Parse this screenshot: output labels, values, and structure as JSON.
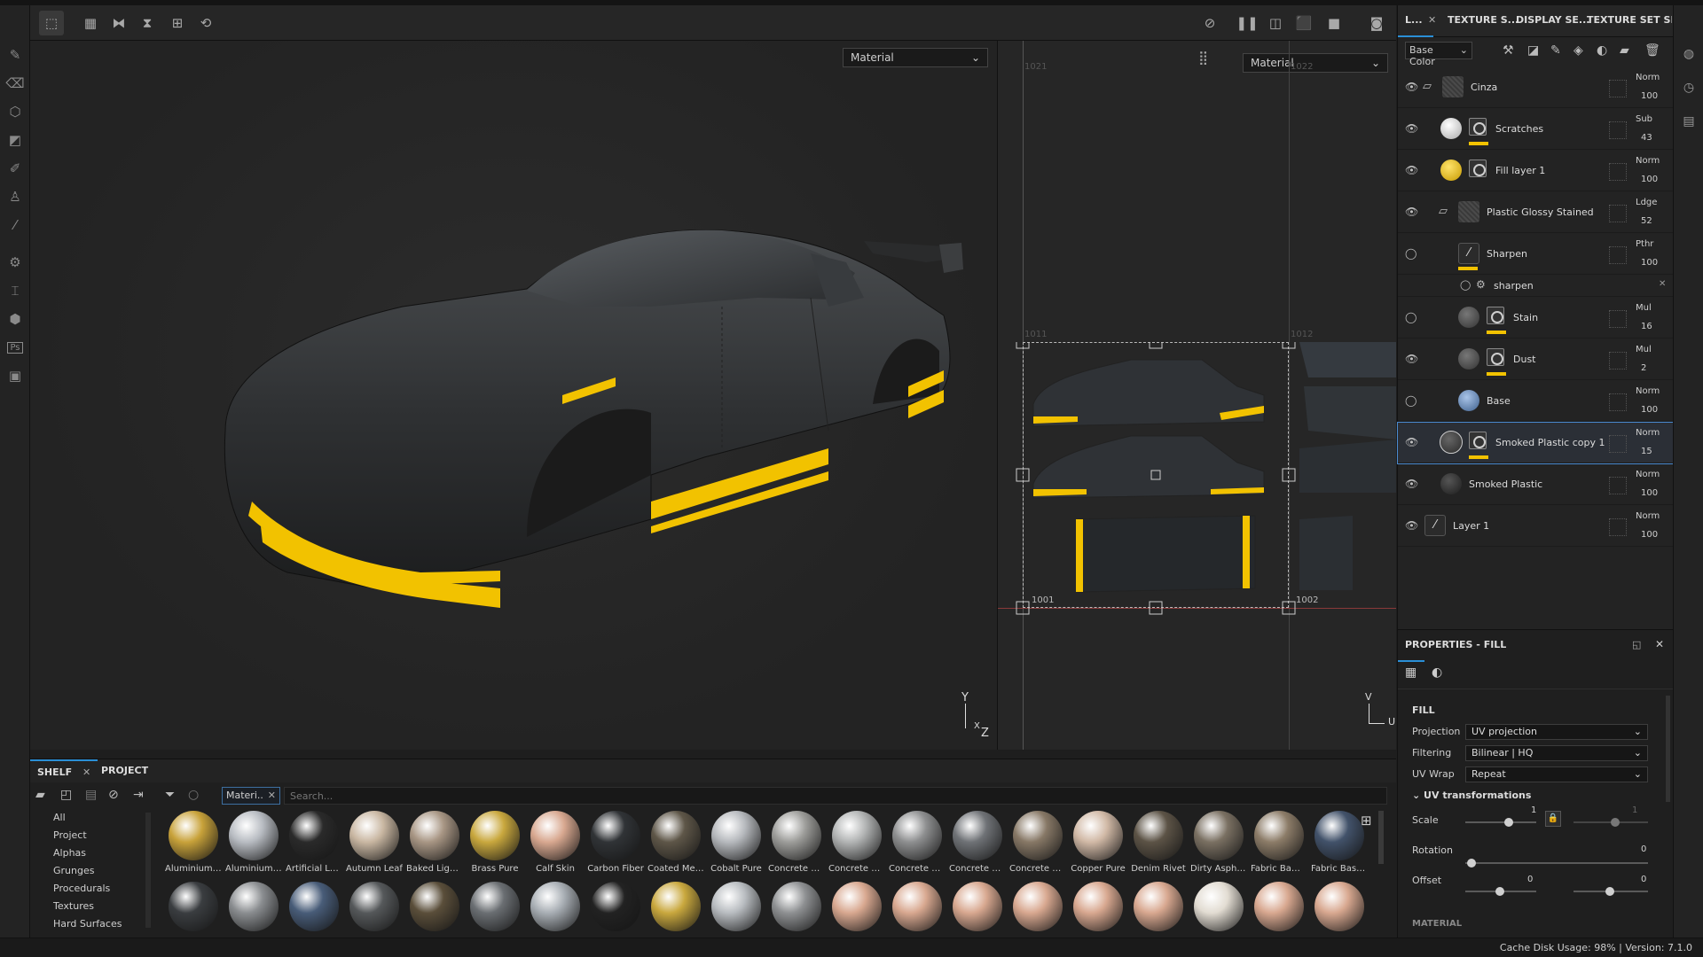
{
  "viewport3d": {
    "mode_label": "Material"
  },
  "viewport2d": {
    "mode_label": "Material",
    "udim": {
      "t1001": "1001",
      "t1002": "1002",
      "t1011": "1011",
      "t1012": "1012",
      "t1021": "1021",
      "t1022": "1022"
    },
    "axis": {
      "v": "V",
      "u": "U"
    }
  },
  "gizmo3d": {
    "y": "Y",
    "x": "X",
    "z": "Z"
  },
  "right_tabs": {
    "layers": "L...",
    "texture_set_list": "TEXTURE S...",
    "display_settings": "DISPLAY SE...",
    "texture_set_settings": "TEXTURE SET SE..."
  },
  "channel_select": "Base Color",
  "layers": [
    {
      "name": "Cinza",
      "blend": "Norm",
      "opacity": "100"
    },
    {
      "name": "Scratches",
      "blend": "Sub",
      "opacity": "43"
    },
    {
      "name": "Fill layer 1",
      "blend": "Norm",
      "opacity": "100"
    },
    {
      "name": "Plastic Glossy Stained",
      "blend": "Ldge",
      "opacity": "52"
    },
    {
      "name": "Sharpen",
      "blend": "Pthr",
      "opacity": "100"
    },
    {
      "name": "sharpen",
      "blend": "",
      "opacity": ""
    },
    {
      "name": "Stain",
      "blend": "Mul",
      "opacity": "16"
    },
    {
      "name": "Dust",
      "blend": "Mul",
      "opacity": "2"
    },
    {
      "name": "Base",
      "blend": "Norm",
      "opacity": "100"
    },
    {
      "name": "Smoked Plastic copy 1",
      "blend": "Norm",
      "opacity": "15"
    },
    {
      "name": "Smoked Plastic",
      "blend": "Norm",
      "opacity": "100"
    },
    {
      "name": "Layer 1",
      "blend": "Norm",
      "opacity": "100"
    }
  ],
  "properties": {
    "title": "PROPERTIES - FILL",
    "section": "FILL",
    "projection_label": "Projection",
    "projection_value": "UV projection",
    "filtering_label": "Filtering",
    "filtering_value": "Bilinear | HQ",
    "uvwrap_label": "UV Wrap",
    "uvwrap_value": "Repeat",
    "uvt_label": "UV transformations",
    "scale_label": "Scale",
    "scale_value": "1",
    "scale_value2": "1",
    "rotation_label": "Rotation",
    "rotation_value": "0",
    "offset_label": "Offset",
    "offset_value": "0",
    "offset_value2": "0",
    "next_section": "MATERIAL"
  },
  "shelf": {
    "tab_shelf": "SHELF",
    "tab_project": "PROJECT",
    "filter_chip": "Materi..",
    "search_placeholder": "Search...",
    "categories": [
      "All",
      "Project",
      "Alphas",
      "Grunges",
      "Procedurals",
      "Textures",
      "Hard Surfaces"
    ],
    "materials_row1": [
      {
        "name": "Aluminium ...",
        "color": "#c8a23a"
      },
      {
        "name": "Aluminium ...",
        "color": "#b8bcc2"
      },
      {
        "name": "Artificial Lea...",
        "color": "#2a2a2a"
      },
      {
        "name": "Autumn Leaf",
        "color": "#c9b7a2"
      },
      {
        "name": "Baked Light...",
        "color": "#a89684"
      },
      {
        "name": "Brass Pure",
        "color": "#c9a83e"
      },
      {
        "name": "Calf Skin",
        "color": "#d8a890"
      },
      {
        "name": "Carbon Fiber",
        "color": "#303336"
      },
      {
        "name": "Coated Metal",
        "color": "#5e5648"
      },
      {
        "name": "Cobalt Pure",
        "color": "#b6b9bd"
      },
      {
        "name": "Concrete B...",
        "color": "#9d9d9a"
      },
      {
        "name": "Concrete Cl...",
        "color": "#b2b4b4"
      },
      {
        "name": "Concrete D...",
        "color": "#8e8f90"
      },
      {
        "name": "Concrete Si...",
        "color": "#6f7276"
      },
      {
        "name": "Concrete S...",
        "color": "#877866"
      },
      {
        "name": "Copper Pure",
        "color": "#d1b9a6"
      },
      {
        "name": "Denim Rivet",
        "color": "#5c5346"
      },
      {
        "name": "Dirty Asphalt",
        "color": "#7a7062"
      },
      {
        "name": "Fabric Bam...",
        "color": "#8c7c68"
      },
      {
        "name": "Fabric Base...",
        "color": "#42526a"
      }
    ],
    "materials_row2": [
      {
        "color": "#3a3d40"
      },
      {
        "color": "#8a8d90"
      },
      {
        "color": "#485c78"
      },
      {
        "color": "#55585a"
      },
      {
        "color": "#5a4e3a"
      },
      {
        "color": "#6a6e72"
      },
      {
        "color": "#a8aeb4"
      },
      {
        "color": "#222222"
      },
      {
        "color": "#c9a83e"
      },
      {
        "color": "#b8bcc0"
      },
      {
        "color": "#8e9092"
      },
      {
        "color": "#d8a890"
      },
      {
        "color": "#d8a890"
      },
      {
        "color": "#d8a890"
      },
      {
        "color": "#d8a890"
      },
      {
        "color": "#d8a890"
      },
      {
        "color": "#d8a890"
      },
      {
        "color": "#e2dcd2"
      },
      {
        "color": "#d8a890"
      },
      {
        "color": "#d8a890"
      }
    ]
  },
  "status": {
    "text": "Cache Disk Usage:  98% | Version: 7.1.0"
  },
  "colors": {
    "accent": "#2a8fd6",
    "stripe_yellow": "#f2c200"
  }
}
